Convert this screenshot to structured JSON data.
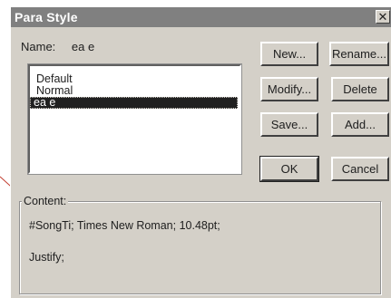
{
  "dialog": {
    "title": "Para Style",
    "close_glyph": "✕"
  },
  "name": {
    "label": "Name:",
    "value": "ea e"
  },
  "styles_list": {
    "items": [
      "Default",
      "Normal",
      "ea e"
    ],
    "selected_index": 2
  },
  "buttons": {
    "new": "New...",
    "rename": "Rename...",
    "modify": "Modify...",
    "delete": "Delete",
    "save": "Save...",
    "add": "Add...",
    "ok": "OK",
    "cancel": "Cancel"
  },
  "content": {
    "label": "Content:",
    "line1": "#SongTi;  Times New Roman;  10.48pt;",
    "line2": "Justify;"
  },
  "colors": {
    "titlebar": "#808080",
    "dialog_bg": "#d4d0c8",
    "callout_line": "#c0392b"
  }
}
